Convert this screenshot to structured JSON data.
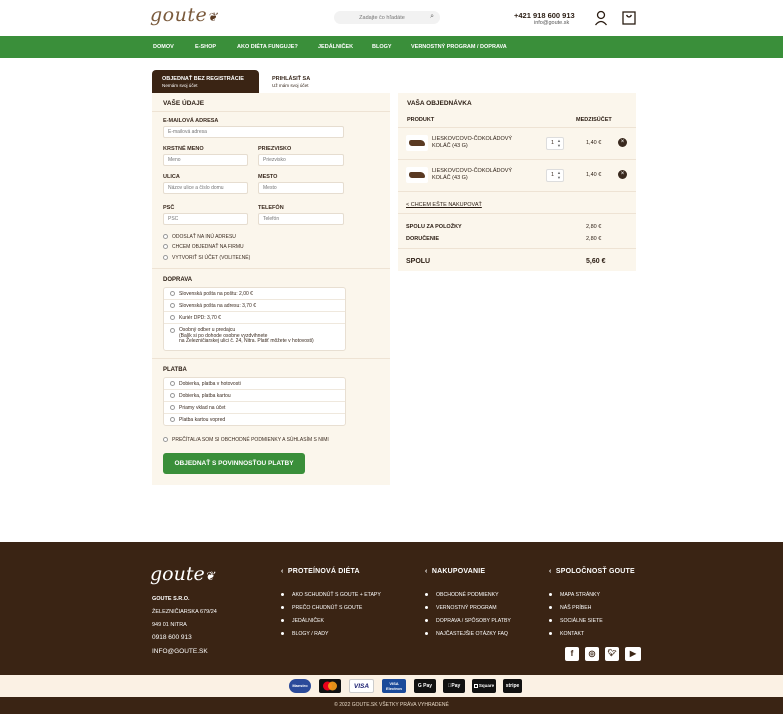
{
  "header": {
    "logo": "goute",
    "search_placeholder": "Zadajte čo hľadáte",
    "phone": "+421 918 600 913",
    "email": "info@goute.sk"
  },
  "nav": [
    "DOMOV",
    "E-SHOP",
    "AKO DIÉTA FUNGUJE?",
    "JEDÁLNIČEK",
    "BLOGY",
    "VERNOSTNÝ PROGRAM / DOPRAVA"
  ],
  "tabs": {
    "guest_title": "OBJEDNAŤ BEZ REGISTRÁCIE",
    "guest_sub": "Nemám svoj účet",
    "login_title": "PRIHLÁSIŤ SA",
    "login_sub": "Už mám svoj účet"
  },
  "form": {
    "title": "VAŠE ÚDAJE",
    "email_label": "E-MAILOVÁ ADRESA",
    "email_ph": "E-mailová adresa",
    "first_label": "KRSTNÉ MENO",
    "first_ph": "Meno",
    "last_label": "PRIEZVISKO",
    "last_ph": "Priezvisko",
    "street_label": "ULICA",
    "street_ph": "Názov ulice a číslo domu",
    "city_label": "MESTO",
    "city_ph": "Mesto",
    "zip_label": "PSČ",
    "zip_ph": "PSČ",
    "phone_label": "TELEFÓN",
    "phone_ph": "Telefón",
    "opt_other_address": "ODOSLAŤ NA INÚ ADRESU",
    "opt_company": "CHCEM OBJEDNAŤ NA FIRMU",
    "opt_account": "VYTVORIŤ SI ÚČET (VOLITEĽNÉ)",
    "shipping_title": "DOPRAVA",
    "shipping": [
      "Slovenská pošta na poštu: 2,00 €",
      "Slovenská pošta na adresu: 3,70 €",
      "Kuriér DPD: 3,70 €"
    ],
    "pickup_line1": "Osobný odber u predajcu",
    "pickup_line2": "(Balík si po dohode osobne vyzdvihnete",
    "pickup_line3": "na Železničiarskej ulici č. 24, Nitra. Platiť môžete v hotovosti)",
    "payment_title": "PLATBA",
    "payment": [
      "Dobierka, platba v hotovosti",
      "Dobierka, platba kartou",
      "Priamy vklad na účet",
      "Platba kartou vopred"
    ],
    "terms": "PREČÍTAL/A SOM SI OBCHODNÉ PODMIENKY A SÚHLASÍM S NIMI",
    "submit": "OBJEDNAŤ S POVINNOSŤOU PLATBY"
  },
  "order": {
    "title": "VAŠA OBJEDNÁVKA",
    "col_product": "PRODUKT",
    "col_subtotal": "MEDZISÚČET",
    "items": [
      {
        "name": "LIESKOVCOVO-ČOKOLÁDOVÝ KOLÁČ (43 G)",
        "qty": "1",
        "price": "1,40 €"
      },
      {
        "name": "LIESKOVCOVO-ČOKOLÁDOVÝ KOLÁČ (43 G)",
        "qty": "1",
        "price": "1,40 €"
      }
    ],
    "continue": "< CHCEM EŠTE NAKUPOVAŤ",
    "items_total_label": "SPOLU ZA POLOŽKY",
    "items_total": "2,80 €",
    "delivery_label": "DORUČENIE",
    "delivery": "2,80 €",
    "total_label": "SPOLU",
    "total": "5,60 €"
  },
  "footer": {
    "logo": "goute",
    "company": "GOUTE S.R.O.",
    "street": "ŽELEZNIČIARSKA 679/24",
    "city": "949 01 NITRA",
    "phone": "0918 600 913",
    "email": "INFO@GOUTE.SK",
    "col1_title": "PROTEÍNOVÁ DIÉTA",
    "col1": [
      "AKO SCHUDNÚŤ S GOUTE + ETAPY",
      "PREČO CHUDNÚŤ S GOUTE",
      "JEDÁLNIČEK",
      "BLOGY / RADY"
    ],
    "col2_title": "NAKUPOVANIE",
    "col2": [
      "OBCHODNÉ PODMIENKY",
      "VERNOSTNÝ PROGRAM",
      "DOPRAVA / SPÔSOBY PLATBY",
      "NAJČASTEJŠIE OTÁZKY FAQ"
    ],
    "col3_title": "SPOLOČNOSŤ GOUTE",
    "col3": [
      "MAPA STRÁNKY",
      "NÁŠ PRÍBEH",
      "SOCIÁLNE SIETE",
      "KONTAKT"
    ],
    "copyright": "© 2022 GOUTE.SK VŠETKY PRÁVA VYHRADENÉ"
  },
  "payments": {
    "maestro": "Maestro",
    "visa": "VISA",
    "visa_electron_1": "VISA",
    "visa_electron_2": "Electron",
    "gpay": "G Pay",
    "applepay": "Pay",
    "square": "Square",
    "stripe": "stripe"
  },
  "colors": {
    "green": "#3a8f3a",
    "brown": "#3a2414",
    "cream": "#fbf6ec"
  }
}
